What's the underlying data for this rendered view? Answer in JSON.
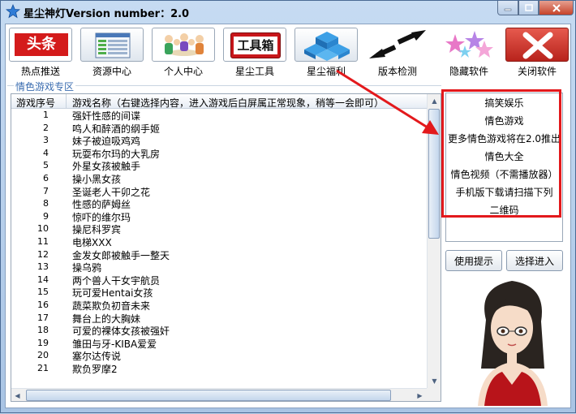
{
  "window": {
    "title": "星尘神灯Version number：2.0"
  },
  "toolbar": {
    "items": [
      {
        "label": "热点推送",
        "icon": "hot-news-icon",
        "badge": "头条"
      },
      {
        "label": "资源中心",
        "icon": "resource-window-icon"
      },
      {
        "label": "个人中心",
        "icon": "people-group-icon"
      },
      {
        "label": "星尘工具",
        "icon": "toolbox-icon",
        "badge": "工具箱"
      },
      {
        "label": "星尘福利",
        "icon": "cubes-icon"
      },
      {
        "label": "版本检测",
        "icon": "double-arrow-icon"
      },
      {
        "label": "隐藏软件",
        "icon": "stars-icon"
      },
      {
        "label": "关闭软件",
        "icon": "close-x-icon"
      }
    ]
  },
  "section": {
    "title": "情色游戏专区"
  },
  "list": {
    "headers": [
      "游戏序号",
      "游戏名称（右键选择内容，进入游戏后白屏属正常现象，稍等一会即可）"
    ],
    "rows": [
      {
        "num": "1",
        "name": "强奸性感的间谍"
      },
      {
        "num": "2",
        "name": "鸣人和醉酒的纲手姬"
      },
      {
        "num": "3",
        "name": "妹子被迫吸鸡鸡"
      },
      {
        "num": "4",
        "name": "玩耍布尔玛的大乳房"
      },
      {
        "num": "5",
        "name": "外星女孩被触手"
      },
      {
        "num": "6",
        "name": "操小黑女孩"
      },
      {
        "num": "7",
        "name": "圣诞老人干卯之花"
      },
      {
        "num": "8",
        "name": "性感的萨姆丝"
      },
      {
        "num": "9",
        "name": "惊吓的维尔玛"
      },
      {
        "num": "10",
        "name": "操尼科罗宾"
      },
      {
        "num": "11",
        "name": "电梯XXX"
      },
      {
        "num": "12",
        "name": "金发女郎被触手一整天"
      },
      {
        "num": "13",
        "name": "操乌鸦"
      },
      {
        "num": "14",
        "name": "两个兽人干女宇航员"
      },
      {
        "num": "15",
        "name": "玩可爱Hentai女孩"
      },
      {
        "num": "16",
        "name": "蔬菜欺负初音未来"
      },
      {
        "num": "17",
        "name": "舞台上的大胸妹"
      },
      {
        "num": "18",
        "name": "可爱的裸体女孩被强奸"
      },
      {
        "num": "19",
        "name": "雏田与牙-KIBA爱爱"
      },
      {
        "num": "20",
        "name": "塞尔达传说"
      },
      {
        "num": "21",
        "name": "欺负罗摩2"
      }
    ]
  },
  "categories": {
    "items": [
      "搞笑娱乐",
      "情色游戏",
      "更多情色游戏将在2.0推出",
      "情色大全",
      "情色视频（不需播放器）",
      "手机版下载请扫描下列",
      "二维码"
    ]
  },
  "buttons": {
    "help": "使用提示",
    "enter": "选择进入"
  },
  "colors": {
    "annotation": "#e3191c",
    "section_title": "#3b6db0"
  }
}
